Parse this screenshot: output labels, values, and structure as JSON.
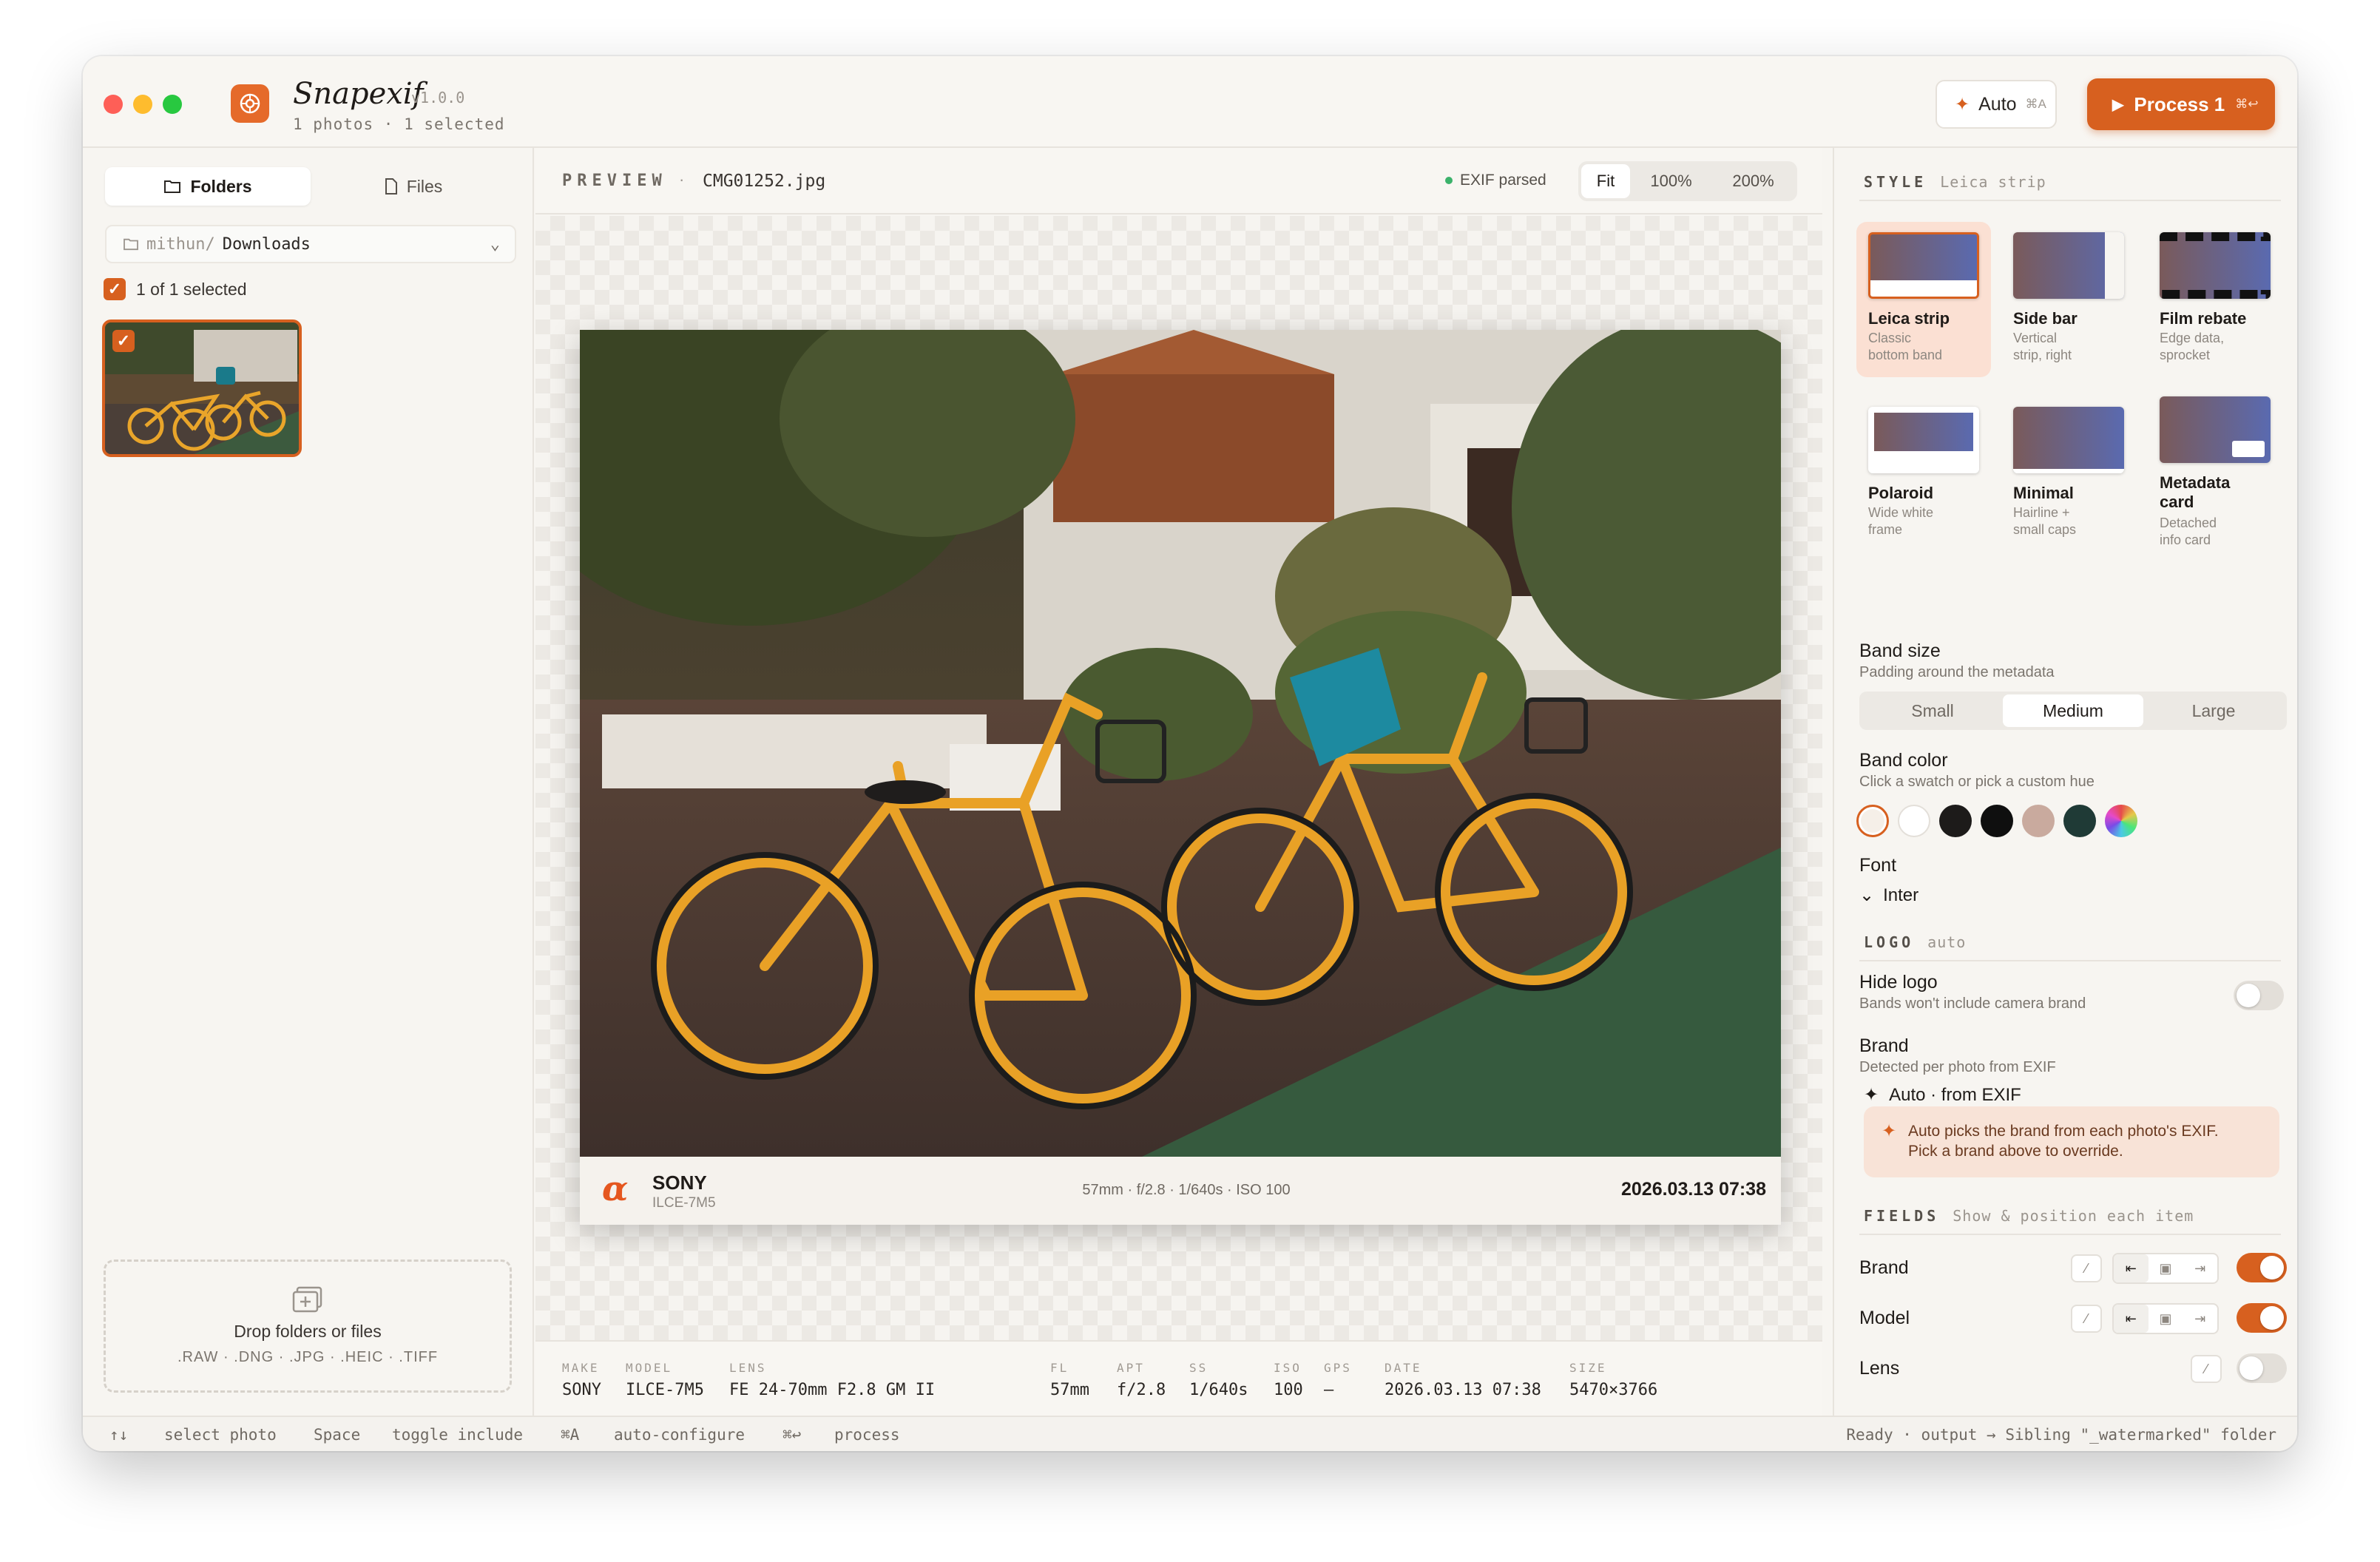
{
  "app": {
    "name": "Snapexif",
    "version": "v1.0.0",
    "subtitle": "1 photos · 1 selected"
  },
  "header": {
    "auto_label": "Auto",
    "auto_shortcut": "⌘A",
    "process_label": "Process 1",
    "process_shortcut": "⌘↩"
  },
  "sidebar": {
    "tabs": [
      {
        "label": "Folders",
        "icon": "folder-icon"
      },
      {
        "label": "Files",
        "icon": "file-icon"
      }
    ],
    "path_prefix": "mithun/",
    "path_folder": "Downloads",
    "selection_text": "1 of 1 selected",
    "drop_title": "Drop folders or files",
    "drop_formats": ".RAW · .DNG · .JPG · .HEIC · .TIFF"
  },
  "preview": {
    "label": "PREVIEW",
    "separator": "·",
    "filename": "CMG01252.jpg",
    "exif_status": "EXIF parsed",
    "zoom": [
      "Fit",
      "100%",
      "200%"
    ],
    "band": {
      "logo": "α",
      "brand": "SONY",
      "model": "ILCE-7M5",
      "settings": "57mm · f/2.8 · 1/640s · ISO 100",
      "date": "2026.03.13 07:38"
    }
  },
  "metadata": [
    {
      "label": "MAKE",
      "value": "SONY"
    },
    {
      "label": "MODEL",
      "value": "ILCE-7M5"
    },
    {
      "label": "LENS",
      "value": "FE 24-70mm F2.8 GM II"
    },
    {
      "label": "FL",
      "value": "57mm"
    },
    {
      "label": "APT",
      "value": "f/2.8"
    },
    {
      "label": "SS",
      "value": "1/640s"
    },
    {
      "label": "ISO",
      "value": "100"
    },
    {
      "label": "GPS",
      "value": "—"
    },
    {
      "label": "DATE",
      "value": "2026.03.13 07:38"
    },
    {
      "label": "SIZE",
      "value": "5470×3766"
    }
  ],
  "style_panel": {
    "title": "STYLE",
    "current": "Leica strip",
    "styles": [
      {
        "name": "Leica strip",
        "desc1": "Classic",
        "desc2": "bottom band"
      },
      {
        "name": "Side bar",
        "desc1": "Vertical",
        "desc2": "strip, right"
      },
      {
        "name": "Film rebate",
        "desc1": "Edge data,",
        "desc2": "sprocket"
      },
      {
        "name": "Polaroid",
        "desc1": "Wide white",
        "desc2": "frame"
      },
      {
        "name": "Minimal",
        "desc1": "Hairline +",
        "desc2": "small caps"
      },
      {
        "name": "Metadata",
        "name2": "card",
        "desc1": "Detached",
        "desc2": "info card"
      }
    ],
    "band_size": {
      "label": "Band size",
      "sub": "Padding around the metadata",
      "options": [
        "Small",
        "Medium",
        "Large"
      ],
      "selected": "Medium"
    },
    "band_color": {
      "label": "Band color",
      "sub": "Click a swatch or pick a custom hue",
      "swatches": [
        "#f5efe8",
        "#ffffff",
        "#1d1b1a",
        "#0f0f0f",
        "#c9aa9e",
        "#1f3a36",
        "rainbow"
      ]
    },
    "font": {
      "label": "Font",
      "value": "Inter"
    }
  },
  "logo_panel": {
    "title": "LOGO",
    "sub": "auto",
    "hide_logo": {
      "label": "Hide logo",
      "sub": "Bands won't include camera brand",
      "on": false
    },
    "brand": {
      "label": "Brand",
      "sub": "Detected per photo from EXIF",
      "value": "Auto · from EXIF"
    },
    "note_line1": "Auto picks the brand from each photo's EXIF.",
    "note_line2": "Pick a brand above to override."
  },
  "fields_panel": {
    "title": "FIELDS",
    "sub": "Show & position each item",
    "fields": [
      {
        "name": "Brand",
        "on": true
      },
      {
        "name": "Model",
        "on": true
      },
      {
        "name": "Lens",
        "on": false
      }
    ]
  },
  "statusbar": {
    "k1": "↑↓",
    "a1": "select photo",
    "k2": "Space",
    "a2": "toggle include",
    "k3": "⌘A",
    "a3": "auto-configure",
    "k4": "⌘↩",
    "a4": "process",
    "right": "Ready · output → Sibling \"_watermarked\" folder"
  },
  "colors": {
    "accent": "#d7601f",
    "bg": "#f7f5f1",
    "exif_ok": "#3bb26b"
  }
}
